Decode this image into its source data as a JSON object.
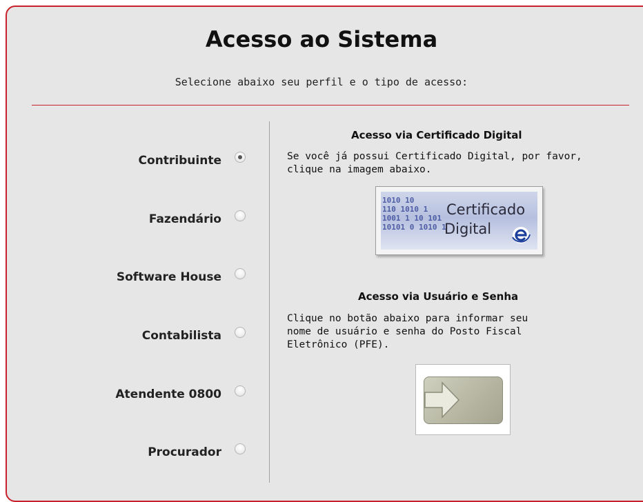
{
  "header": {
    "title": "Acesso ao Sistema",
    "subtitle": "Selecione abaixo seu perfil e o tipo de acesso:"
  },
  "profiles": [
    {
      "label": "Contribuinte",
      "checked": true
    },
    {
      "label": "Fazendário",
      "checked": false
    },
    {
      "label": "Software House",
      "checked": false
    },
    {
      "label": "Contabilista",
      "checked": false
    },
    {
      "label": "Atendente 0800",
      "checked": false
    },
    {
      "label": "Procurador",
      "checked": false
    }
  ],
  "certificado": {
    "title": "Acesso via Certificado Digital",
    "line1": "Se você já possui Certificado Digital, por favor,",
    "line2": "clique na imagem abaixo.",
    "button_line1": "Certificado",
    "button_line2": "Digital",
    "icon": "e-cert-logo-icon"
  },
  "usuario": {
    "title": "Acesso via Usuário e Senha",
    "line1": "Clique no botão abaixo para informar seu",
    "line2": "nome de usuário e senha do Posto Fiscal",
    "line3": "Eletrônico (PFE).",
    "icon": "arrow-right-icon"
  },
  "colors": {
    "accent": "#c8202a",
    "panel_bg": "#e6e6e6"
  }
}
